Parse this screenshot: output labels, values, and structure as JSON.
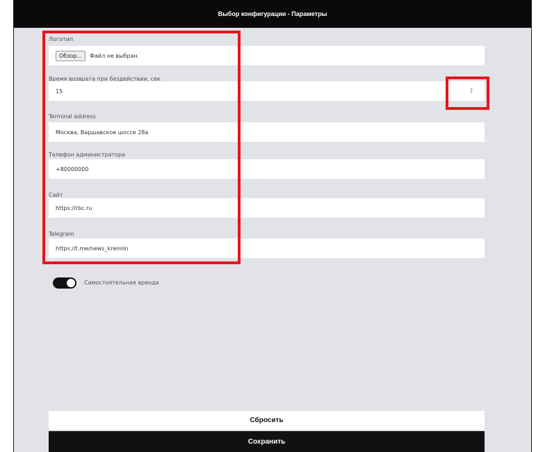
{
  "header": {
    "title": "Выбор конфигурации - Параметры"
  },
  "form": {
    "logo": {
      "label": "Логотип",
      "browse_label": "Обзор...",
      "file_status": "Файл не выбран."
    },
    "idle_return": {
      "label": "Время возврата при бездействии, сек",
      "value": "15"
    },
    "terminal_address": {
      "label": "Terminal address",
      "value": "Москва, Варшавское шоссе 28а"
    },
    "admin_phone": {
      "label": "Телефон администратора",
      "value": "+80000000"
    },
    "site": {
      "label": "Сайт",
      "value": "https://rbc.ru"
    },
    "telegram": {
      "label": "Telegram",
      "value": "https://t.me/news_kremlin"
    },
    "self_rent": {
      "label": "Самостоятельная аренда",
      "enabled": true
    }
  },
  "actions": {
    "reset_label": "Сбросить",
    "save_label": "Сохранить"
  },
  "icons": {
    "spinner_up": "▲",
    "spinner_down": "▼"
  },
  "colors": {
    "highlight": "#e8141c",
    "header_bg": "#0a0a0a",
    "page_bg": "#e2e3e8",
    "save_bg": "#111111"
  }
}
